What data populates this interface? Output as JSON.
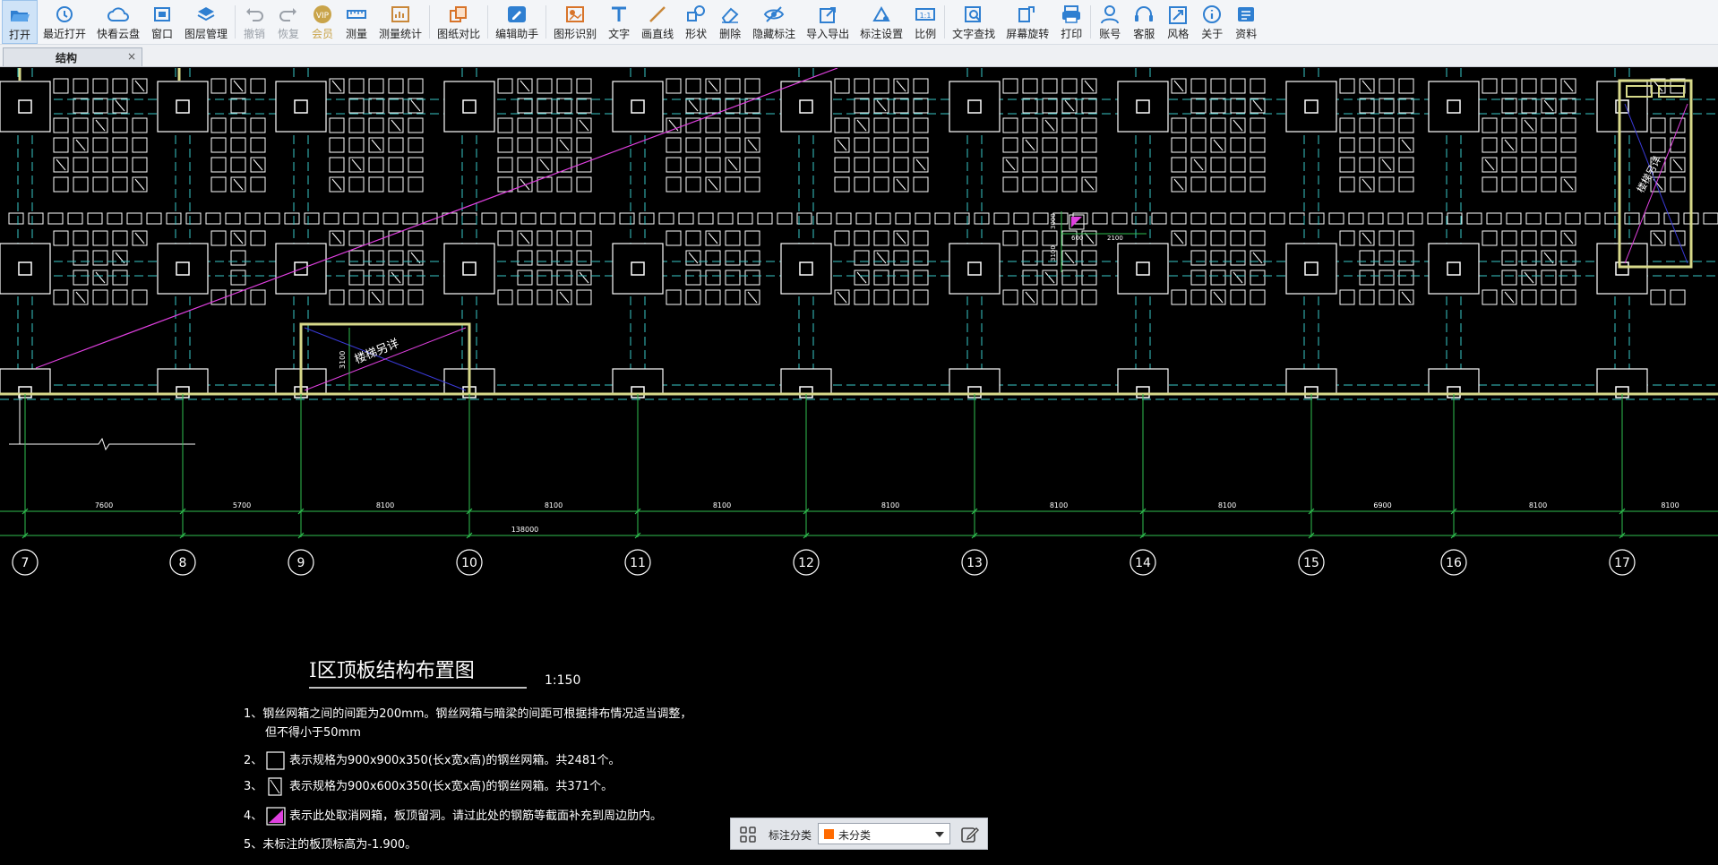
{
  "toolbar": {
    "buttons": [
      {
        "label": "打开",
        "icon": "folder-open-icon"
      },
      {
        "label": "最近打开",
        "icon": "history-icon"
      },
      {
        "label": "快看云盘",
        "icon": "cloud-icon"
      },
      {
        "label": "窗口",
        "icon": "window-icon"
      },
      {
        "label": "图层管理",
        "icon": "layers-icon"
      },
      {
        "label": "撤销",
        "icon": "undo-icon"
      },
      {
        "label": "恢复",
        "icon": "redo-icon"
      },
      {
        "label": "会员",
        "icon": "vip-icon"
      },
      {
        "label": "测量",
        "icon": "ruler-icon"
      },
      {
        "label": "测量统计",
        "icon": "measure-stats-icon"
      },
      {
        "label": "图纸对比",
        "icon": "compare-icon"
      },
      {
        "label": "编辑助手",
        "icon": "edit-assistant-icon"
      },
      {
        "label": "图形识别",
        "icon": "shape-recognition-icon"
      },
      {
        "label": "文字",
        "icon": "text-icon"
      },
      {
        "label": "画直线",
        "icon": "line-icon"
      },
      {
        "label": "形状",
        "icon": "shape-icon"
      },
      {
        "label": "删除",
        "icon": "eraser-icon"
      },
      {
        "label": "隐藏标注",
        "icon": "hide-eye-icon"
      },
      {
        "label": "导入导出",
        "icon": "import-export-icon"
      },
      {
        "label": "标注设置",
        "icon": "annotation-settings-icon"
      },
      {
        "label": "比例",
        "icon": "scale-icon"
      },
      {
        "label": "文字查找",
        "icon": "text-search-icon"
      },
      {
        "label": "屏幕旋转",
        "icon": "rotate-screen-icon"
      },
      {
        "label": "打印",
        "icon": "printer-icon"
      },
      {
        "label": "账号",
        "icon": "user-icon"
      },
      {
        "label": "客服",
        "icon": "headset-icon"
      },
      {
        "label": "风格",
        "icon": "style-icon"
      },
      {
        "label": "关于",
        "icon": "info-icon"
      },
      {
        "label": "资料",
        "icon": "docs-icon"
      }
    ]
  },
  "tab": {
    "label": "结构",
    "close": "×"
  },
  "drawing": {
    "title": "I区顶板结构布置图",
    "scale": "1:150",
    "notes": [
      "1、钢丝网箱之间的间距为200mm。钢丝网箱与暗梁的间距可根据排布情况适当调整，",
      "但不得小于50mm",
      "2、",
      "表示规格为900x900x350(长x宽x高)的钢丝网箱。共2481个。",
      "3、",
      "表示规格为900x600x350(长x宽x高)的钢丝网箱。共371个。",
      "4、",
      "表示此处取消网箱，板顶留洞。请过此处的钢筋等截面补充到周边肋内。",
      "5、未标注的板顶标高为-1.900。"
    ],
    "axis_labels": [
      "7",
      "8",
      "9",
      "10",
      "11",
      "12",
      "13",
      "14",
      "15",
      "16",
      "17"
    ],
    "span_dims": [
      "7600",
      "5700",
      "8100",
      "8100",
      "8100",
      "8100",
      "8100",
      "8100",
      "6900",
      "8100",
      "8100"
    ],
    "overall_dim": "138000",
    "opening_label": "楼梯另详",
    "opening_dim": "3100",
    "small_dims": [
      "3000",
      "600",
      "2100",
      "3100"
    ],
    "stair_label": "楼梯另详"
  },
  "annotation_bar": {
    "label": "标注分类",
    "selected": "未分类",
    "swatch_color": "#ff6a00"
  },
  "colors": {
    "toolbar_icon": "#2f7fd1",
    "cad_white": "#ffffff",
    "cad_yellow": "#d7d98a",
    "cad_cyan": "#38c8c8",
    "cad_green": "#2fbf4f",
    "cad_magenta": "#e040e0"
  }
}
